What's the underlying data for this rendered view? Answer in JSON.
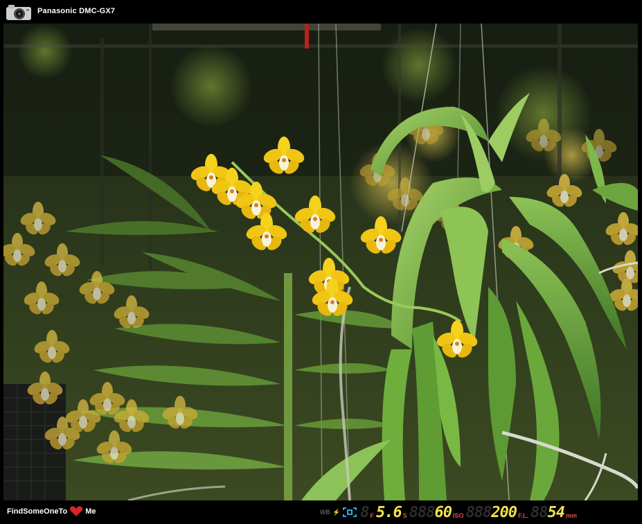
{
  "header": {
    "camera_model": "Panasonic DMC-GX7"
  },
  "footer": {
    "brand_left": "FindSomeOneTo",
    "brand_right": "Me",
    "exif": {
      "wb_label": "WB",
      "aperture_label": "F",
      "aperture_value": "5.6",
      "shutter_label": "S",
      "shutter_value": "60",
      "iso_label": "ISO",
      "iso_value": "200",
      "focal_label": "F.L.",
      "focal_value": "54",
      "focal_unit": "mm"
    }
  },
  "colors": {
    "accent": "#f2e24b",
    "label": "#e74c3c",
    "af_icon": "#2aa8e0"
  }
}
